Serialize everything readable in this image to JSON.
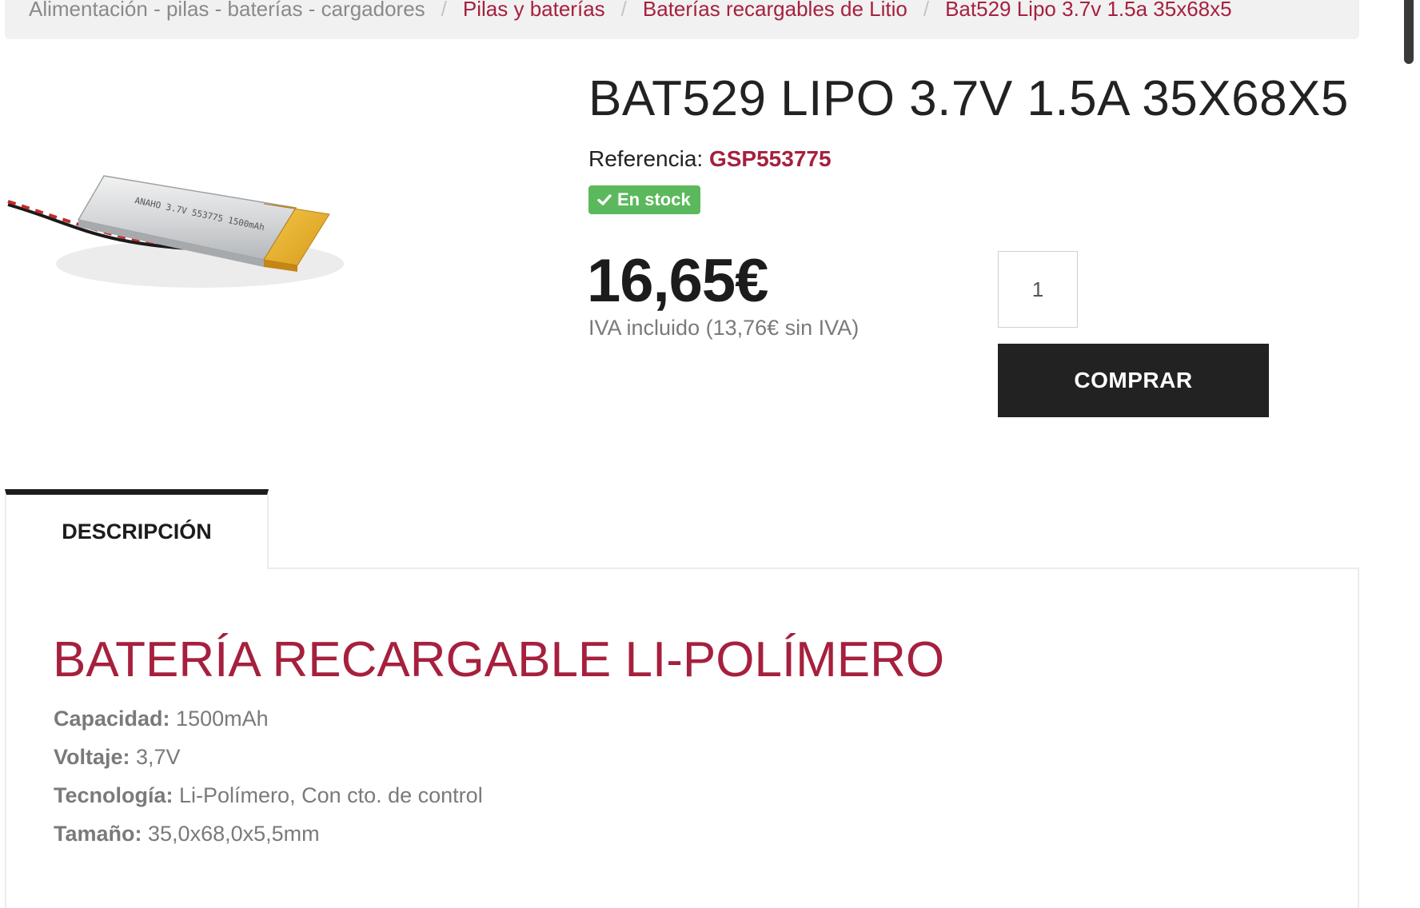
{
  "breadcrumb": {
    "items": [
      {
        "label": "Alimentación - pilas - baterías - cargadores"
      },
      {
        "label": "Pilas y baterías"
      },
      {
        "label": "Baterías recargables de Litio"
      },
      {
        "label": "Bat529 Lipo 3.7v 1.5a 35x68x5"
      }
    ],
    "separator": "/"
  },
  "product": {
    "title": "BAT529 LIPO 3.7V 1.5A 35X68X5",
    "reference_label": "Referencia:",
    "reference_value": "GSP553775",
    "stock_label": "En stock",
    "price": "16,65€",
    "tax_note": "IVA incluido (13,76€ sin IVA)",
    "quantity_value": "1",
    "buy_label": "COMPRAR",
    "image_text": "ANAHO 3.7V 553775 1500mAh",
    "image_icon": "battery-product-image"
  },
  "tabs": {
    "description_label": "DESCRIPCIÓN"
  },
  "description": {
    "heading": "BATERÍA RECARGABLE LI-POLÍMERO",
    "specs": [
      {
        "label": "Capacidad:",
        "value": " 1500mAh"
      },
      {
        "label": "Voltaje:",
        "value": " 3,7V"
      },
      {
        "label": "Tecnología:",
        "value": " Li-Polímero, Con cto. de control"
      },
      {
        "label": "Tamaño:",
        "value": " 35,0x68,0x5,5mm"
      }
    ]
  },
  "colors": {
    "accent": "#a6203e",
    "stock_green": "#5cb85c",
    "button_dark": "#222222",
    "muted_text": "#7a7a7a"
  }
}
